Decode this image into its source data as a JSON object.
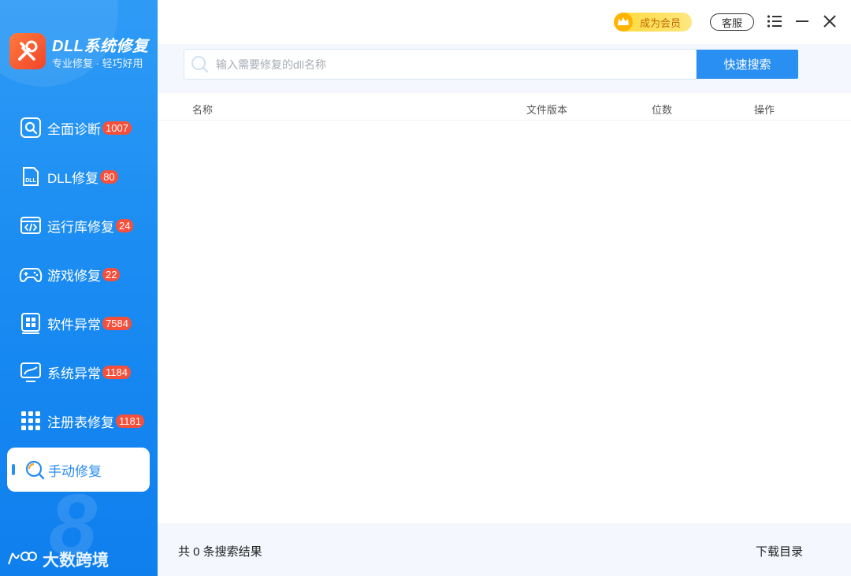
{
  "app": {
    "title": "DLL系统修复",
    "subtitle": "专业修复 · 轻巧好用"
  },
  "sidebar": {
    "items": [
      {
        "label": "全面诊断",
        "badge": "1007",
        "icon": "search-icon"
      },
      {
        "label": "DLL修复",
        "badge": "80",
        "icon": "dll-file-icon"
      },
      {
        "label": "运行库修复",
        "badge": "24",
        "icon": "code-window-icon"
      },
      {
        "label": "游戏修复",
        "badge": "22",
        "icon": "gamepad-icon"
      },
      {
        "label": "软件异常",
        "badge": "7584",
        "icon": "app-grid-icon"
      },
      {
        "label": "系统异常",
        "badge": "1184",
        "icon": "monitor-chart-icon"
      },
      {
        "label": "注册表修复",
        "badge": "1181",
        "icon": "registry-grid-icon"
      }
    ],
    "active": {
      "label": "手动修复",
      "icon": "search-refresh-icon"
    },
    "watermark": "大数跨境"
  },
  "topbar": {
    "vip_label": "成为会员",
    "service_label": "客服"
  },
  "search": {
    "placeholder": "输入需要修复的dll名称",
    "button_label": "快速搜索"
  },
  "table": {
    "columns": [
      "名称",
      "文件版本",
      "位数",
      "操作"
    ],
    "rows": []
  },
  "footer": {
    "result_text": "共 0 条搜索结果",
    "download_label": "下载目录"
  },
  "colors": {
    "accent": "#2a8ff2",
    "sidebar": "#1a8cf2",
    "badge": "#f4503c",
    "vip": "#ffd93a"
  }
}
